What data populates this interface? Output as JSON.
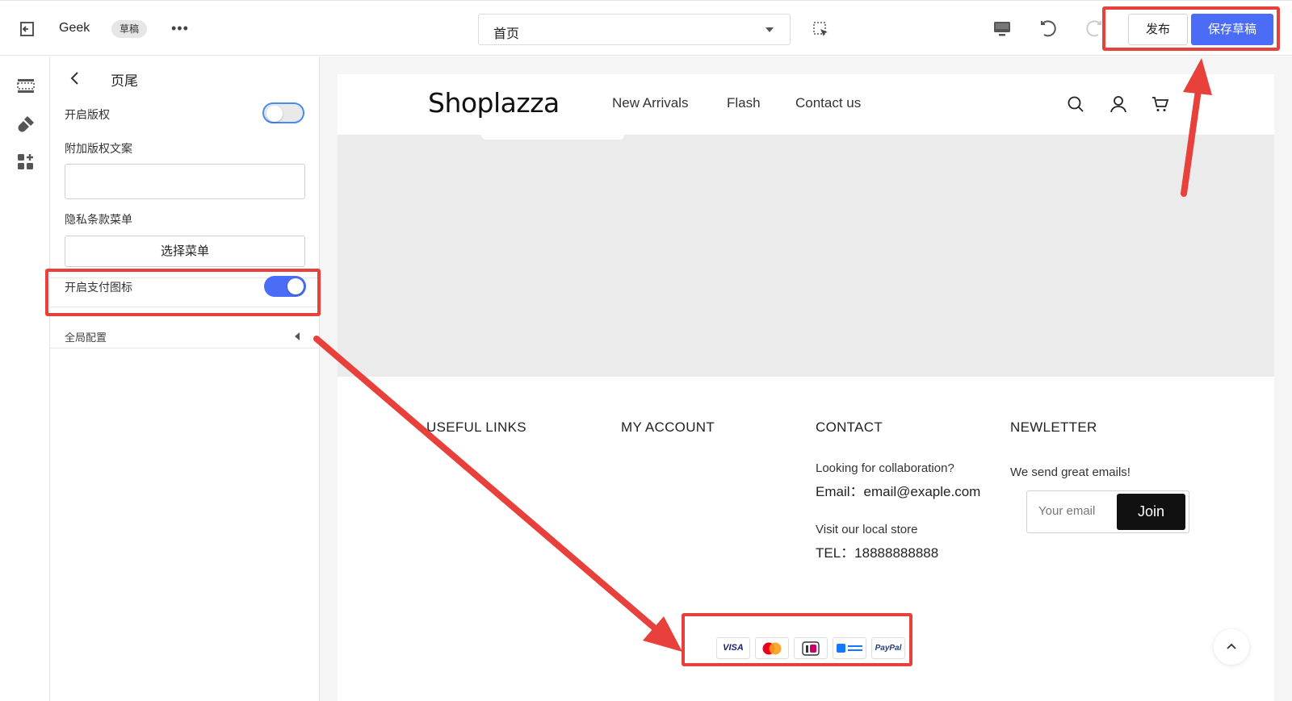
{
  "topbar": {
    "store_name": "Geek",
    "status_badge": "草稿",
    "more_label": "•••",
    "page_select_value": "首页",
    "publish_label": "发布",
    "save_draft_label": "保存草稿"
  },
  "panel": {
    "title": "页尾",
    "copyright_label": "开启版权",
    "copyright_enabled": false,
    "extra_copyright_label": "附加版权文案",
    "extra_copyright_value": "",
    "privacy_menu_label": "隐私条款菜单",
    "select_menu_label": "选择菜单",
    "payment_icons_label": "开启支付图标",
    "payment_icons_enabled": true,
    "global_config_label": "全局配置"
  },
  "site": {
    "logo": "Shoplazza",
    "nav": [
      "New Arrivals",
      "Flash",
      "Contact us"
    ]
  },
  "footer": {
    "useful_links_title": "USEFUL LINKS",
    "my_account_title": "MY ACCOUNT",
    "contact_title": "CONTACT",
    "collab_text": "Looking for collaboration?",
    "email_text": "Email：email@exaple.com",
    "visit_text": "Visit our local store",
    "tel_text": "TEL：18888888888",
    "newsletter_title": "NEWLETTER",
    "newsletter_text": "We send great emails!",
    "email_placeholder": "Your email",
    "join_label": "Join"
  },
  "payments": {
    "visa": "VISA",
    "paypal": "PayPal"
  },
  "colors": {
    "accent": "#4a6cf7",
    "annotation": "#e8403a"
  }
}
